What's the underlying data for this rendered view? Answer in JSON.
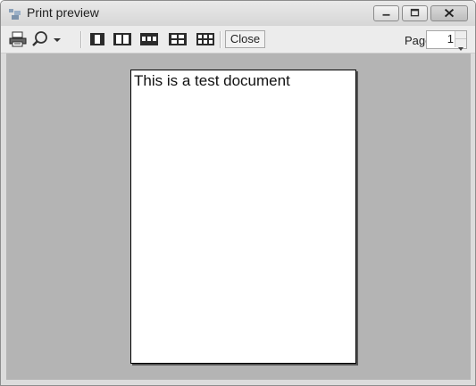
{
  "window": {
    "title": "Print preview"
  },
  "toolbar": {
    "print_icon": "printer-icon",
    "zoom_icon": "magnifier-icon",
    "layouts": [
      "one-page-icon",
      "two-pages-icon",
      "three-pages-icon",
      "four-pages-icon",
      "six-pages-icon"
    ],
    "close_label": "Close",
    "page_label": "Page",
    "page_value": "1"
  },
  "document": {
    "text": "This is a test document"
  }
}
